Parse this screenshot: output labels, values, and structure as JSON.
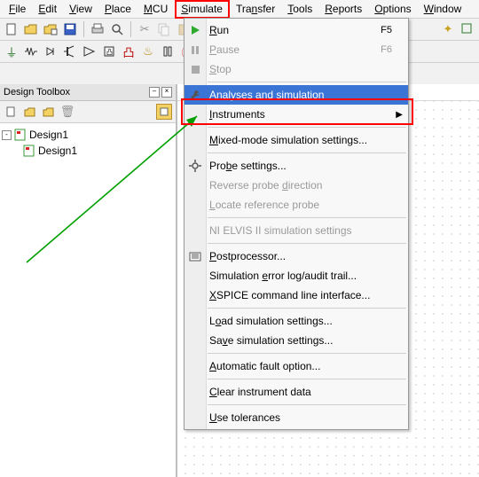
{
  "menubar": {
    "items": [
      {
        "pre": "",
        "u": "F",
        "post": "ile"
      },
      {
        "pre": "",
        "u": "E",
        "post": "dit"
      },
      {
        "pre": "",
        "u": "V",
        "post": "iew"
      },
      {
        "pre": "",
        "u": "P",
        "post": "lace"
      },
      {
        "pre": "",
        "u": "M",
        "post": "CU"
      },
      {
        "pre": "",
        "u": "S",
        "post": "imulate"
      },
      {
        "pre": "Tra",
        "u": "n",
        "post": "sfer"
      },
      {
        "pre": "",
        "u": "T",
        "post": "ools"
      },
      {
        "pre": "",
        "u": "R",
        "post": "eports"
      },
      {
        "pre": "",
        "u": "O",
        "post": "ptions"
      },
      {
        "pre": "",
        "u": "W",
        "post": "indow"
      }
    ]
  },
  "dropdown": {
    "items": [
      {
        "type": "item",
        "icon": "play-green",
        "pre": "",
        "u": "R",
        "post": "un",
        "shortcut": "F5",
        "disabled": false
      },
      {
        "type": "item",
        "icon": "pause-grey",
        "pre": "",
        "u": "P",
        "post": "ause",
        "shortcut": "F6",
        "disabled": true
      },
      {
        "type": "item",
        "icon": "stop-grey",
        "pre": "",
        "u": "S",
        "post": "top",
        "shortcut": "",
        "disabled": true
      },
      {
        "type": "sep"
      },
      {
        "type": "item",
        "icon": "wrench",
        "pre": "Analyses an",
        "u": "d",
        "post": " simulation",
        "shortcut": "",
        "disabled": false,
        "highlight": true
      },
      {
        "type": "item",
        "icon": "",
        "pre": "",
        "u": "I",
        "post": "nstruments",
        "shortcut": "",
        "disabled": false,
        "submenu": true
      },
      {
        "type": "sep"
      },
      {
        "type": "item",
        "icon": "",
        "pre": "",
        "u": "M",
        "post": "ixed-mode simulation settings...",
        "shortcut": "",
        "disabled": false
      },
      {
        "type": "sep"
      },
      {
        "type": "item",
        "icon": "gear",
        "pre": "Pro",
        "u": "b",
        "post": "e settings...",
        "shortcut": "",
        "disabled": false
      },
      {
        "type": "item",
        "icon": "",
        "pre": "Reverse probe ",
        "u": "d",
        "post": "irection",
        "shortcut": "",
        "disabled": true
      },
      {
        "type": "item",
        "icon": "",
        "pre": "",
        "u": "L",
        "post": "ocate reference probe",
        "shortcut": "",
        "disabled": true
      },
      {
        "type": "sep"
      },
      {
        "type": "item",
        "icon": "",
        "pre": "NI ELVIS II simulation settin",
        "u": "g",
        "post": "s",
        "shortcut": "",
        "disabled": true
      },
      {
        "type": "sep"
      },
      {
        "type": "item",
        "icon": "postproc",
        "pre": "",
        "u": "P",
        "post": "ostprocessor...",
        "shortcut": "",
        "disabled": false
      },
      {
        "type": "item",
        "icon": "",
        "pre": "Simulation ",
        "u": "e",
        "post": "rror log/audit trail...",
        "shortcut": "",
        "disabled": false
      },
      {
        "type": "item",
        "icon": "",
        "pre": "",
        "u": "X",
        "post": "SPICE command line interface...",
        "shortcut": "",
        "disabled": false
      },
      {
        "type": "sep"
      },
      {
        "type": "item",
        "icon": "",
        "pre": "L",
        "u": "o",
        "post": "ad simulation settings...",
        "shortcut": "",
        "disabled": false
      },
      {
        "type": "item",
        "icon": "",
        "pre": "Sa",
        "u": "v",
        "post": "e simulation settings...",
        "shortcut": "",
        "disabled": false
      },
      {
        "type": "sep"
      },
      {
        "type": "item",
        "icon": "",
        "pre": "",
        "u": "A",
        "post": "utomatic fault option...",
        "shortcut": "",
        "disabled": false
      },
      {
        "type": "sep"
      },
      {
        "type": "item",
        "icon": "",
        "pre": "",
        "u": "C",
        "post": "lear instrument data",
        "shortcut": "",
        "disabled": false
      },
      {
        "type": "sep"
      },
      {
        "type": "item",
        "icon": "",
        "pre": "",
        "u": "U",
        "post": "se tolerances",
        "shortcut": "",
        "disabled": false
      }
    ]
  },
  "design_toolbox": {
    "title": "Design Toolbox",
    "tree": [
      {
        "label": "Design1",
        "level": 0,
        "expander": "-"
      },
      {
        "label": "Design1",
        "level": 1,
        "expander": ""
      }
    ]
  }
}
